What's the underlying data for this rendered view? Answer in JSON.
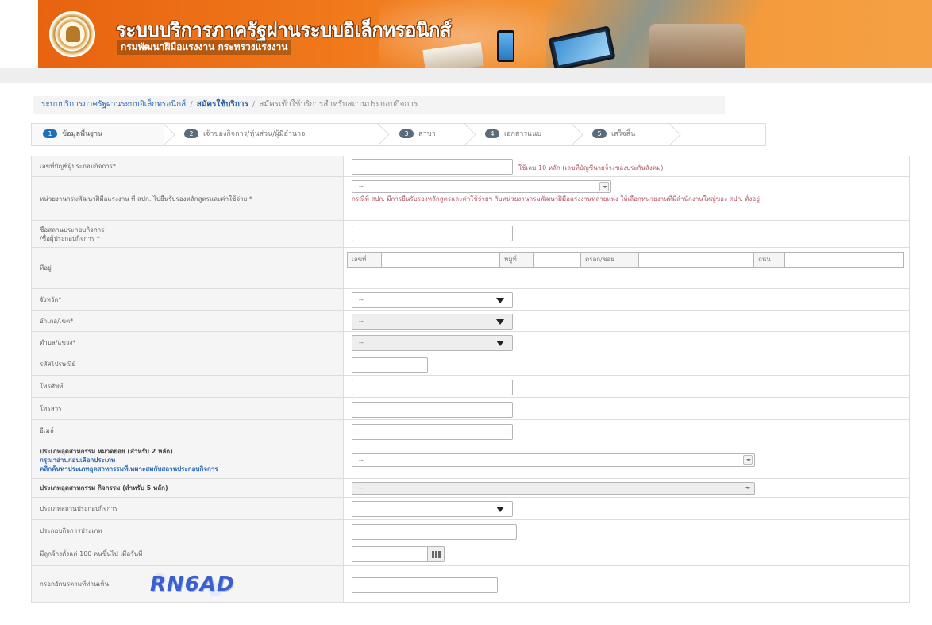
{
  "banner": {
    "title": "ระบบบริการภาครัฐผ่านระบบอิเล็กทรอนิกส์",
    "subtitle": "กรมพัฒนาฝีมือแรงงาน กระทรวงแรงงาน"
  },
  "breadcrumb": {
    "item1": "ระบบบริการภาครัฐผ่านระบบอิเล็กทรอนิกส์",
    "item2": "สมัครใช้บริการ",
    "item3": "สมัครเข้าใช้บริการสำหรับสถานประกอบกิจการ",
    "sep": "/"
  },
  "wizard": {
    "steps": [
      {
        "num": "1",
        "label": "ข้อมูลพื้นฐาน"
      },
      {
        "num": "2",
        "label": "เจ้าของกิจการ/หุ้นส่วน/ผู้มีอำนาจ"
      },
      {
        "num": "3",
        "label": "สาขา"
      },
      {
        "num": "4",
        "label": "เอกสารแนบ"
      },
      {
        "num": "5",
        "label": "เสร็จสิ้น"
      }
    ]
  },
  "form": {
    "employer_id": {
      "label": "เลขที่บัญชีผู้ประกอบกิจการ*",
      "hint": "ใช้เลข 10 หลัก (เลขที่บัญชีนายจ้างของประกันสังคม)"
    },
    "agency": {
      "label": "หน่วยงานกรมพัฒนาฝีมือแรงงาน ที่ สปก. ไปยื่นรับรองหลักสูตรและค่าใช้จ่าย *",
      "value": "--",
      "hint": "กรณีที่ สปก. มีการยื่นรับรองหลักสูตรและค่าใช้จ่ายฯ กับหน่วยงานกรมพัฒนาฝีมือแรงงานหลายแห่ง ให้เลือกหน่วยงานที่มีสำนักงานใหญ่ของ สปก. ตั้งอยู่"
    },
    "company_name": {
      "label1": "ชื่อสถานประกอบกิจการ",
      "label2": "/ชื่อผู้ประกอบกิจการ *"
    },
    "address": {
      "label": "ที่อยู่",
      "no": "เลขที่",
      "moo": "หมู่ที่",
      "soi": "ตรอก/ซอย",
      "road": "ถนน"
    },
    "province": {
      "label": "จังหวัด*",
      "value": "--"
    },
    "district": {
      "label": "อำเภอ/เขต*",
      "value": "--"
    },
    "subdistrict": {
      "label": "ตำบล/แขวง*",
      "value": "--"
    },
    "postcode": {
      "label": "รหัสไปรษณีย์"
    },
    "phone": {
      "label": "โทรศัพท์"
    },
    "fax": {
      "label": "โทรสาร"
    },
    "email": {
      "label": "อีเมล์"
    },
    "isic2": {
      "label1": "ประเภทอุตสาหกรรม หมวดย่อย (สำหรับ 2 หลัก)",
      "label2": "กรุณาอ่านก่อนเลือกประเภท",
      "label3": "คลิกค้นหาประเภทอุตสาหกรรมที่เหมาะสมกับสถานประกอบกิจการ",
      "value": "--"
    },
    "isic5": {
      "label": "ประเภทอุตสาหกรรม กิจกรรม (สำหรับ 5 หลัก)",
      "value": "--"
    },
    "business_type": {
      "label": "ประเภทสถานประกอบกิจการ",
      "value": ""
    },
    "business_category": {
      "label": "ประกอบกิจการประเภท"
    },
    "employ100": {
      "label": "มีลูกจ้างตั้งแต่ 100 คนขึ้นไป เมื่อวันที่"
    },
    "captcha": {
      "label": "กรอกอักษรตามที่ท่านเห็น",
      "code": "RN6AD"
    }
  },
  "colors": {
    "banner_orange": "#f07a1c",
    "step_active": "#1f6fb8",
    "hint_red": "#b05a6a",
    "link_blue": "#2f6ab5"
  }
}
